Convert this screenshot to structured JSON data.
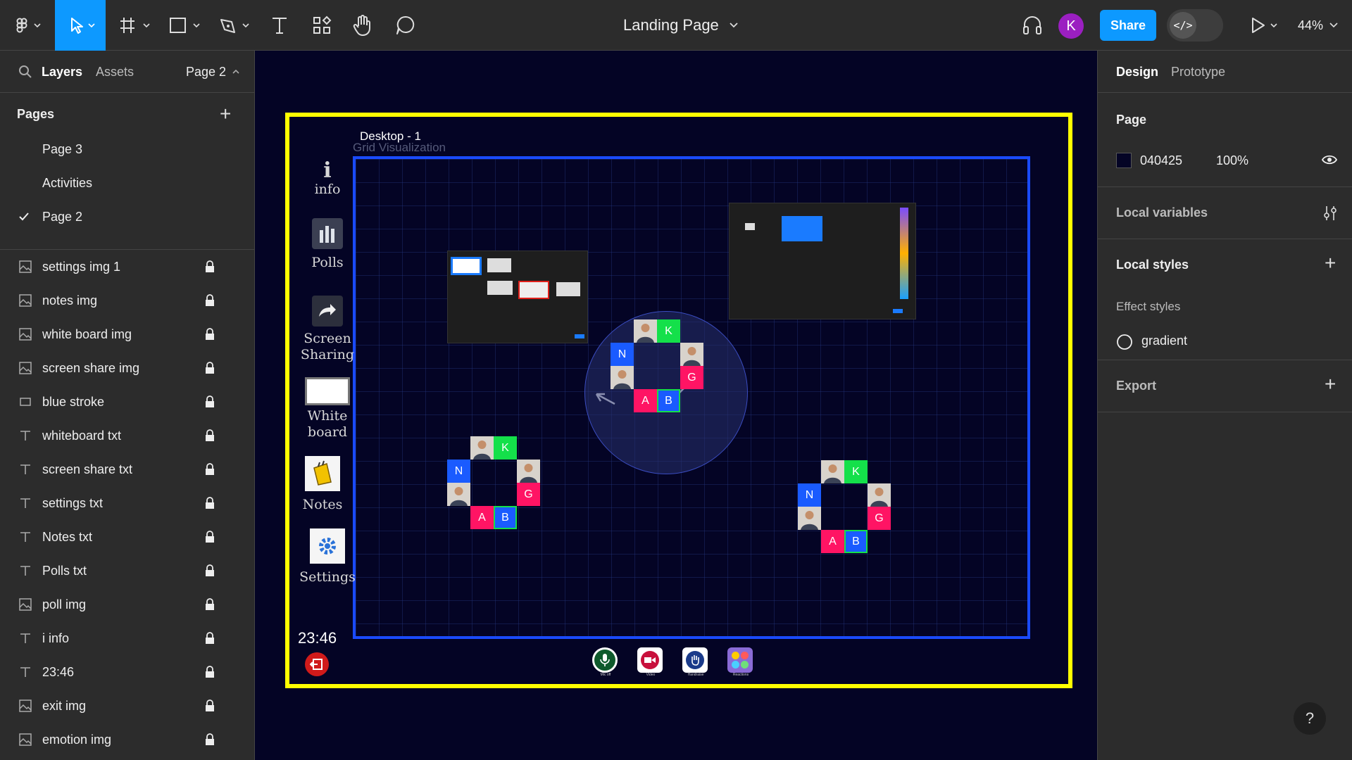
{
  "toolbar": {
    "doc_title": "Landing Page",
    "share_label": "Share",
    "avatar_initial": "K",
    "zoom": "44%",
    "dev_mode_symbol": "</>",
    "tools": [
      "figma-menu-icon",
      "move-tool-icon",
      "frame-tool-icon",
      "shape-tool-icon",
      "pen-tool-icon",
      "text-tool-icon",
      "resources-icon",
      "hand-tool-icon",
      "comment-icon"
    ],
    "accent_color": "#0d99ff"
  },
  "left_panel": {
    "tabs": {
      "layers": "Layers",
      "assets": "Assets",
      "page_selector": "Page 2"
    },
    "pages_heading": "Pages",
    "pages": [
      {
        "name": "Page 3",
        "current": false
      },
      {
        "name": "Activities",
        "current": false
      },
      {
        "name": "Page 2",
        "current": true
      }
    ],
    "layers": [
      {
        "name": "settings img 1",
        "kind": "image"
      },
      {
        "name": "notes img",
        "kind": "image"
      },
      {
        "name": "white board img",
        "kind": "image"
      },
      {
        "name": "screen share img",
        "kind": "image"
      },
      {
        "name": "blue stroke",
        "kind": "rect"
      },
      {
        "name": "whiteboard txt",
        "kind": "text"
      },
      {
        "name": "screen share txt",
        "kind": "text"
      },
      {
        "name": "settings txt",
        "kind": "text"
      },
      {
        "name": "Notes txt",
        "kind": "text"
      },
      {
        "name": "Polls txt",
        "kind": "text"
      },
      {
        "name": "poll img",
        "kind": "image"
      },
      {
        "name": "i info",
        "kind": "text"
      },
      {
        "name": "23:46",
        "kind": "text"
      },
      {
        "name": "exit img",
        "kind": "image"
      },
      {
        "name": "emotion img",
        "kind": "image"
      }
    ]
  },
  "right_panel": {
    "tabs": {
      "design": "Design",
      "prototype": "Prototype"
    },
    "page_heading": "Page",
    "page_color_hex": "040425",
    "page_color": "#040425",
    "page_opacity": "100%",
    "local_variables": "Local variables",
    "local_styles": "Local styles",
    "effect_styles": "Effect styles",
    "effect_style_item": "gradient",
    "export": "Export"
  },
  "canvas": {
    "frame_label": "Desktop - 1",
    "frame_sublabel": "Grid Visualization",
    "frame_color": "#ffff00",
    "grid_color": "#1a4bff",
    "sidebar": {
      "info_icon": "i",
      "info": "info",
      "polls": "Polls",
      "screen_sharing_1": "Screen",
      "screen_sharing_2": "Sharing",
      "whiteboard_1": "White",
      "whiteboard_2": "board",
      "notes": "Notes",
      "settings": "Settings",
      "clock": "23:46"
    },
    "tile_letters": {
      "k": "K",
      "n": "N",
      "g": "G",
      "a": "A",
      "b": "B"
    },
    "bottom_bar": {
      "mic": "Mic off",
      "video": "Video",
      "handraise": "Handraise",
      "reactions": "Reactions"
    }
  },
  "help_label": "?"
}
